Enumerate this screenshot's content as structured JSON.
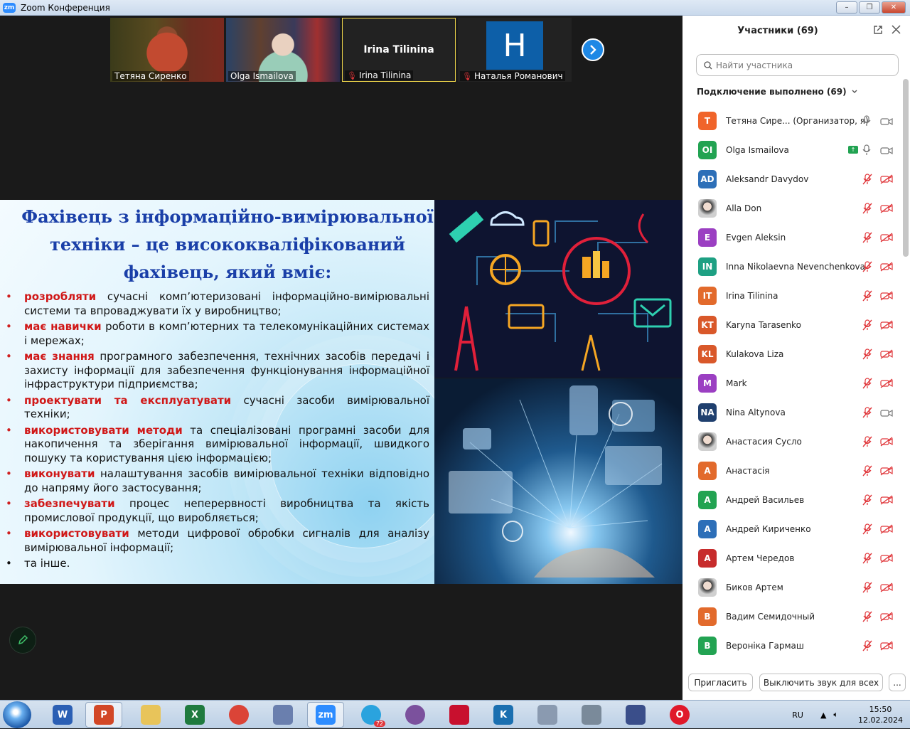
{
  "window": {
    "title": "Zoom Конференция",
    "logo": "zm"
  },
  "video_strip": [
    {
      "name": "Тетяна Сиренко",
      "muted": false
    },
    {
      "name": "Olga Ismailova",
      "muted": false
    },
    {
      "name": "Irina Tilinina",
      "big_label": "Irina Tilinina",
      "muted": true
    },
    {
      "name": "Наталья Романович",
      "avatar_letter": "H",
      "muted": true
    }
  ],
  "slide": {
    "title_lines": [
      "Фахівець з інформаційно-вимірювальної",
      "техніки – це висококваліфікований",
      "фахівець, який вміє:"
    ],
    "bullets": [
      {
        "kw": "розробляти",
        "text": " сучасні комп’ютеризовані інформаційно-вимірювальні системи та впроваджувати їх у виробництво;"
      },
      {
        "kw": "має навички",
        "text": " роботи в комп’ютерних та телекомунікаційних системах і мережах;"
      },
      {
        "kw": "має знання",
        "text": " програмного забезпечення, технічних засобів передачі і захисту інформації для забезпечення функціонування інформаційної інфраструктури підприємства;"
      },
      {
        "kw": "проектувати та експлуатувати",
        "text": " сучасні засоби вимірювальної техніки;"
      },
      {
        "kw": "використовувати методи",
        "text": " та спеціалізовані програмні засоби для накопичення та зберігання вимірювальної інформації, швидкого пошуку та користування цією інформацією;"
      },
      {
        "kw": "виконувати",
        "text": " налаштування засобів вимірювальної техніки відповідно до напряму його застосування;"
      },
      {
        "kw": "забезпечувати",
        "text": " процес неперервності виробництва та якість промислової продукції, що виробляється;"
      },
      {
        "kw": "використовувати",
        "text": " методи цифрової обробки сигналів для аналізу вимірювальної інформації;"
      },
      {
        "kw": "",
        "text": "та інше."
      }
    ]
  },
  "panel": {
    "title": "Участники (69)",
    "search_placeholder": "Найти участника",
    "section_label": "Подключение выполнено (69)",
    "invite_label": "Пригласить",
    "mute_all_label": "Выключить звук для всех",
    "more_label": "...",
    "participants": [
      {
        "initials": "T",
        "name": "Тетяна Сире...  (Организатор, я)",
        "color": "#f0642a",
        "mic": "on",
        "cam": "on"
      },
      {
        "initials": "OI",
        "name": "Olga Ismailova",
        "color": "#22a352",
        "mic": "on",
        "cam": "on",
        "sharing": true
      },
      {
        "initials": "AD",
        "name": "Aleksandr Davydov",
        "color": "#2d6fb8",
        "mic": "off",
        "cam": "off"
      },
      {
        "initials": "",
        "name": "Alla Don",
        "photo": true,
        "mic": "off",
        "cam": "off"
      },
      {
        "initials": "E",
        "name": "Evgen Aleksin",
        "color": "#9b3fc2",
        "mic": "off",
        "cam": "off"
      },
      {
        "initials": "IN",
        "name": "Inna Nikolaevna Nevenchenkova",
        "color": "#1ea083",
        "mic": "off",
        "cam": "off"
      },
      {
        "initials": "IT",
        "name": "Irina Tilinina",
        "color": "#e26a2c",
        "mic": "off",
        "cam": "off"
      },
      {
        "initials": "KT",
        "name": "Karyna Tarasenko",
        "color": "#d9582a",
        "mic": "off",
        "cam": "off"
      },
      {
        "initials": "KL",
        "name": "Kulakova Liza",
        "color": "#d9582a",
        "mic": "off",
        "cam": "off"
      },
      {
        "initials": "M",
        "name": "Mark",
        "color": "#9b3fc2",
        "mic": "off",
        "cam": "off"
      },
      {
        "initials": "NA",
        "name": "Nina Altynova",
        "color": "#1f3f6e",
        "mic": "off",
        "cam": "on"
      },
      {
        "initials": "",
        "name": "Анастасия Сусло",
        "photo": true,
        "mic": "off",
        "cam": "off"
      },
      {
        "initials": "A",
        "name": "Анастасія",
        "color": "#e26a2c",
        "mic": "off",
        "cam": "off"
      },
      {
        "initials": "A",
        "name": "Андрей Васильев",
        "color": "#22a352",
        "mic": "off",
        "cam": "off"
      },
      {
        "initials": "A",
        "name": "Андрей Кириченко",
        "color": "#2d6fb8",
        "mic": "off",
        "cam": "off"
      },
      {
        "initials": "A",
        "name": "Артем Чередов",
        "color": "#c72c2c",
        "mic": "off",
        "cam": "off"
      },
      {
        "initials": "",
        "name": "Биков Артем",
        "photo": true,
        "mic": "off",
        "cam": "off"
      },
      {
        "initials": "B",
        "name": "Вадим Семидочный",
        "color": "#e26a2c",
        "mic": "off",
        "cam": "off"
      },
      {
        "initials": "B",
        "name": "Вероніка Гармаш",
        "color": "#22a352",
        "mic": "off",
        "cam": "off"
      }
    ]
  },
  "taskbar": {
    "apps": [
      {
        "name": "word",
        "label": "W",
        "color": "#2b5fb4"
      },
      {
        "name": "powerpoint",
        "label": "P",
        "color": "#d24726"
      },
      {
        "name": "explorer",
        "label": "",
        "color": "#e8c45a"
      },
      {
        "name": "excel",
        "label": "X",
        "color": "#1f7a3e"
      },
      {
        "name": "chrome",
        "label": "",
        "color": "#db4437"
      },
      {
        "name": "paint",
        "label": "",
        "color": "#6a7fae"
      },
      {
        "name": "zoom",
        "label": "zm",
        "color": "#2d8cff"
      },
      {
        "name": "telegram",
        "label": "",
        "color": "#2aa3de",
        "badge": "72"
      },
      {
        "name": "viber",
        "label": "",
        "color": "#7b519d"
      },
      {
        "name": "app-red",
        "label": "",
        "color": "#c8102e"
      },
      {
        "name": "app-k",
        "label": "K",
        "color": "#1a6fb0"
      },
      {
        "name": "calculator",
        "label": "",
        "color": "#8a9ab0"
      },
      {
        "name": "network",
        "label": "",
        "color": "#7a8a9a"
      },
      {
        "name": "pen-tool",
        "label": "",
        "color": "#3a4e8a"
      },
      {
        "name": "opera",
        "label": "O",
        "color": "#e0192a"
      }
    ],
    "lang": "RU",
    "time": "15:50",
    "date": "12.02.2024"
  }
}
